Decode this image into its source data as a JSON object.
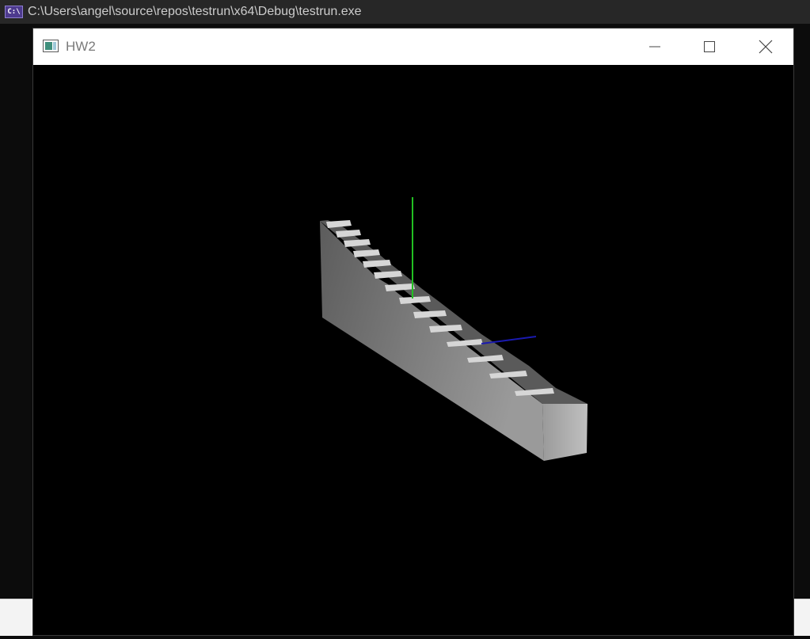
{
  "console": {
    "icon_text": "C:\\",
    "title": "C:\\Users\\angel\\source\\repos\\testrun\\x64\\Debug\\testrun.exe"
  },
  "window": {
    "title": "HW2",
    "icons": [
      "app-icon",
      "minimize-icon",
      "maximize-icon",
      "close-icon"
    ]
  },
  "scene": {
    "background": "#000000",
    "axis_colors": {
      "y": "#22c022",
      "z": "#1a1ab0"
    },
    "shading": {
      "side": "#808080",
      "top": "#555555",
      "end": "#a8a8a8",
      "step": "#d4d4d4"
    }
  }
}
